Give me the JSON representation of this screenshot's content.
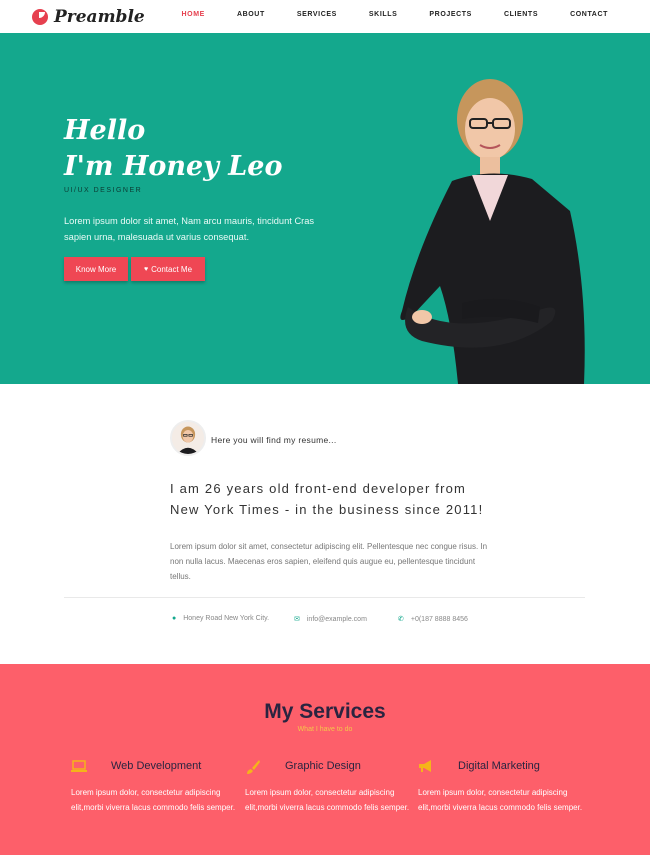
{
  "logo": {
    "text": "Preamble"
  },
  "nav": {
    "items": [
      "HOME",
      "ABOUT",
      "SERVICES",
      "SKILLS",
      "PROJECTS",
      "CLIENTS",
      "CONTACT"
    ]
  },
  "hero": {
    "greeting_line1": "Hello",
    "greeting_line2": "I'm Honey Leo",
    "role": "UI/UX DESIGNER",
    "description": "Lorem ipsum dolor sit amet, Nam arcu mauris, tincidunt Cras sapien urna, malesuada ut varius consequat.",
    "button_primary": "Know More",
    "button_secondary": "Contact Me"
  },
  "about": {
    "intro": "Here you will find my resume...",
    "headline": "I am 26 years old front-end developer from New York Times - in the business since 2011!",
    "text": "Lorem ipsum dolor sit amet, consectetur adipiscing elit. Pellentesque nec congue risus. In non nulla lacus. Maecenas eros sapien, eleifend quis augue eu, pellentesque tincidunt tellus.",
    "address": "Honey Road New York City.",
    "email": "info@example.com",
    "phone": "+0(187 8888 8456"
  },
  "services": {
    "title": "My Services",
    "subtitle": "What I have to do",
    "items": [
      {
        "name": "Web Development",
        "icon": "laptop-icon",
        "text": "Lorem ipsum dolor, consectetur adipiscing elit,morbi viverra lacus commodo felis semper."
      },
      {
        "name": "Graphic Design",
        "icon": "paintbrush-icon",
        "text": "Lorem ipsum dolor, consectetur adipiscing elit,morbi viverra lacus commodo felis semper."
      },
      {
        "name": "Digital Marketing",
        "icon": "megaphone-icon",
        "text": "Lorem ipsum dolor, consectetur adipiscing elit,morbi viverra lacus commodo felis semper."
      }
    ]
  },
  "colors": {
    "teal": "#14a88d",
    "red": "#ef4754",
    "coral": "#fd5f6a",
    "gold": "#f5b41a"
  }
}
